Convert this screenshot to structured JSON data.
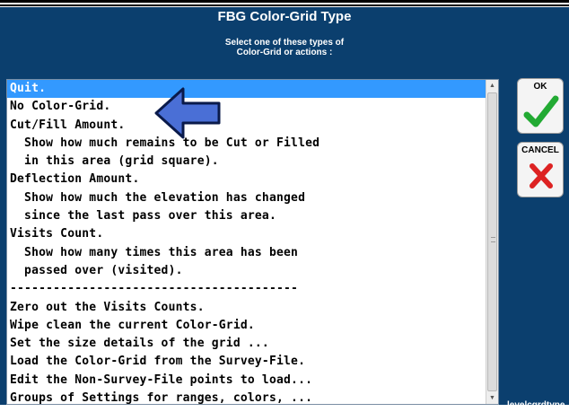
{
  "dialog": {
    "title": "FBG Color-Grid Type",
    "subtitle_line1": "Select one of these types of",
    "subtitle_line2": "Color-Grid or actions :",
    "corner_label": "levelcgrdtype"
  },
  "list": {
    "selected_index": 0,
    "items": [
      "Quit.",
      "No Color-Grid.",
      "Cut/Fill Amount.",
      "  Show how much remains to be Cut or Filled",
      "  in this area (grid square).",
      "Deflection Amount.",
      "  Show how much the elevation has changed",
      "  since the last pass over this area.",
      "Visits Count.",
      "  Show how many times this area has been",
      "  passed over (visited).",
      "----------------------------------------",
      "Zero out the Visits Counts.",
      "Wipe clean the current Color-Grid.",
      "Set the size details of the grid ...",
      "Load the Color-Grid from the Survey-File.",
      "Edit the Non-Survey-File points to load...",
      "Groups of Settings for ranges, colors, ..."
    ]
  },
  "buttons": {
    "ok_label": "OK",
    "ok_icon": "checkmark-icon",
    "cancel_label": "CANCEL",
    "cancel_icon": "x-icon"
  },
  "overlay": {
    "icon": "left-arrow-icon",
    "color": "#4a6fd6"
  },
  "colors": {
    "dialog_bg": "#0b3f6e",
    "selection": "#3399ff",
    "ok_green": "#22aa33",
    "cancel_red": "#dd2222"
  }
}
